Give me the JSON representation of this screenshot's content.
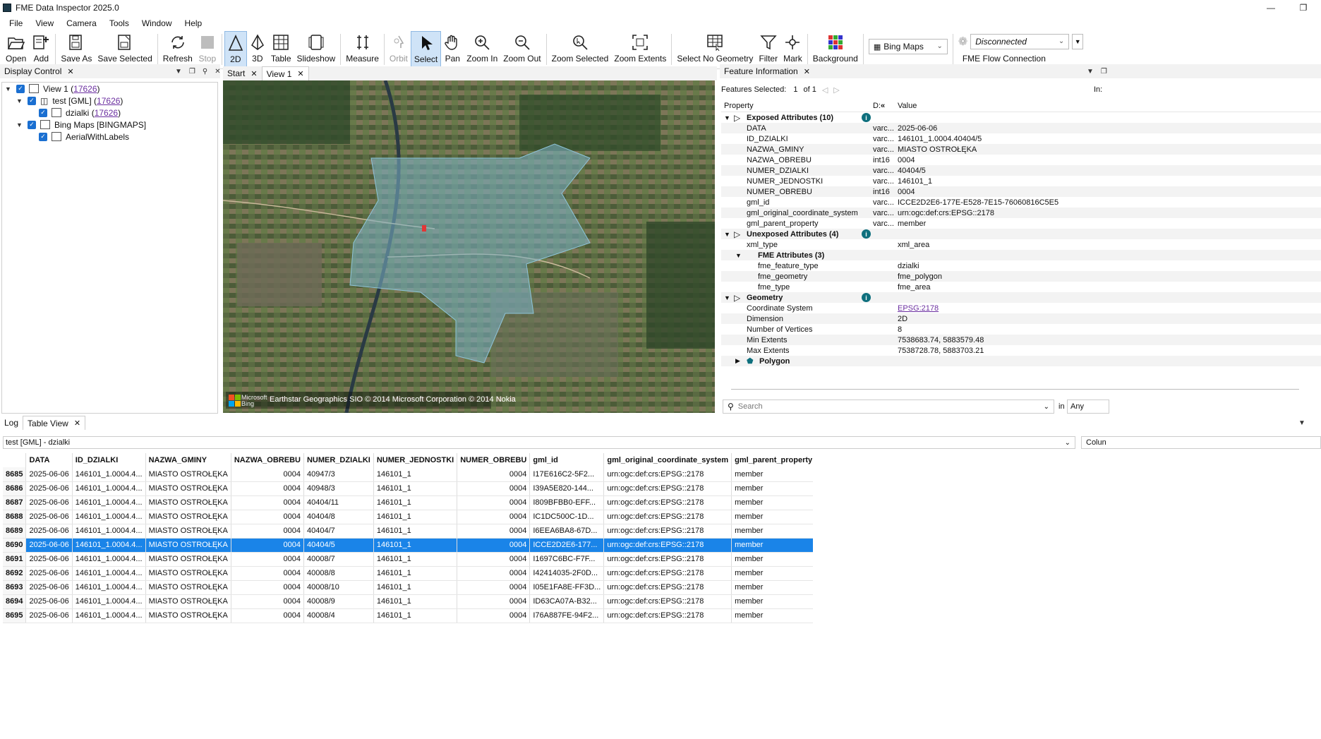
{
  "app": {
    "title": "FME Data Inspector 2025.0"
  },
  "menu": [
    "File",
    "View",
    "Camera",
    "Tools",
    "Window",
    "Help"
  ],
  "toolbar": {
    "open": "Open",
    "add": "Add",
    "save_as": "Save As",
    "save_selected": "Save Selected",
    "refresh": "Refresh",
    "stop": "Stop",
    "view_2d": "2D",
    "view_3d": "3D",
    "table": "Table",
    "slideshow": "Slideshow",
    "measure": "Measure",
    "orbit": "Orbit",
    "select": "Select",
    "pan": "Pan",
    "zoom_in": "Zoom In",
    "zoom_out": "Zoom Out",
    "zoom_selected": "Zoom Selected",
    "zoom_extents": "Zoom Extents",
    "select_no_geometry": "Select No Geometry",
    "filter": "Filter",
    "mark": "Mark",
    "background": "Background",
    "background_combo": "Bing Maps",
    "connection_combo": "Disconnected",
    "connection_label": "FME Flow Connection"
  },
  "display_control": {
    "title": "Display Control",
    "tree": {
      "view": "View 1",
      "view_count": "17626",
      "dataset": "test [GML]",
      "dataset_count": "17626",
      "feature_type": "dzialki",
      "feature_type_count": "17626",
      "background": "Bing Maps [BINGMAPS]",
      "background_layer": "AerialWithLabels"
    }
  },
  "view_tabs": {
    "start": "Start",
    "view1": "View 1"
  },
  "map": {
    "attribution": "Earthstar Geographics SIO © 2014 Microsoft Corporation © 2014 Nokia",
    "logo_top": "Microsoft",
    "logo_bottom": "Bing"
  },
  "feature_info": {
    "title": "Feature Information",
    "selected_label": "Features Selected:",
    "selected_index": "1",
    "selected_of": "of 1",
    "right_label": "In:",
    "col_property": "Property",
    "col_type": "D:",
    "col_value": "Value",
    "exposed_header": "Exposed Attributes (10)",
    "exposed": [
      {
        "name": "DATA",
        "type": "varc...",
        "value": "2025-06-06"
      },
      {
        "name": "ID_DZIALKI",
        "type": "varc...",
        "value": "146101_1.0004.40404/5"
      },
      {
        "name": "NAZWA_GMINY",
        "type": "varc...",
        "value": "MIASTO OSTROŁĘKA"
      },
      {
        "name": "NAZWA_OBREBU",
        "type": "int16",
        "value": "0004"
      },
      {
        "name": "NUMER_DZIALKI",
        "type": "varc...",
        "value": "40404/5"
      },
      {
        "name": "NUMER_JEDNOSTKI",
        "type": "varc...",
        "value": "146101_1"
      },
      {
        "name": "NUMER_OBREBU",
        "type": "int16",
        "value": "0004"
      },
      {
        "name": "gml_id",
        "type": "varc...",
        "value": "ICCE2D2E6-177E-E528-7E15-76060816C5E5"
      },
      {
        "name": "gml_original_coordinate_system",
        "type": "varc...",
        "value": "urn:ogc:def:crs:EPSG::2178"
      },
      {
        "name": "gml_parent_property",
        "type": "varc...",
        "value": "member"
      }
    ],
    "unexposed_header": "Unexposed Attributes (4)",
    "xml_type_name": "xml_type",
    "xml_type_value": "xml_area",
    "fme_header": "FME Attributes (3)",
    "fme_attrs": [
      {
        "name": "fme_feature_type",
        "value": "dzialki"
      },
      {
        "name": "fme_geometry",
        "value": "fme_polygon"
      },
      {
        "name": "fme_type",
        "value": "fme_area"
      }
    ],
    "geometry_header": "Geometry",
    "geometry": [
      {
        "name": "Coordinate System",
        "value": "EPSG:2178"
      },
      {
        "name": "Dimension",
        "value": "2D"
      },
      {
        "name": "Number of Vertices",
        "value": "8"
      },
      {
        "name": "Min Extents",
        "value": "7538683.74, 5883579.48"
      },
      {
        "name": "Max Extents",
        "value": "7538728.78, 5883703.21"
      }
    ],
    "polygon_label": "Polygon",
    "search_placeholder": "Search",
    "in_label": "in",
    "in_value": "Any"
  },
  "bottom_tabs": {
    "log": "Log",
    "table_view": "Table View"
  },
  "table": {
    "source": "test [GML] - dzialki",
    "columns_button": "Colun",
    "columns": [
      "DATA",
      "ID_DZIALKI",
      "NAZWA_GMINY",
      "NAZWA_OBREBU",
      "NUMER_DZIALKI",
      "NUMER_JEDNOSTKI",
      "NUMER_OBREBU",
      "gml_id",
      "gml_original_coordinate_system",
      "gml_parent_property"
    ],
    "rows": [
      [
        "8685",
        "2025-06-06",
        "146101_1.0004.4...",
        "MIASTO OSTROŁĘKA",
        "0004",
        "40947/3",
        "146101_1",
        "0004",
        "I17E616C2-5F2...",
        "urn:ogc:def:crs:EPSG::2178",
        "member"
      ],
      [
        "8686",
        "2025-06-06",
        "146101_1.0004.4...",
        "MIASTO OSTROŁĘKA",
        "0004",
        "40948/3",
        "146101_1",
        "0004",
        "I39A5E820-144...",
        "urn:ogc:def:crs:EPSG::2178",
        "member"
      ],
      [
        "8687",
        "2025-06-06",
        "146101_1.0004.4...",
        "MIASTO OSTROŁĘKA",
        "0004",
        "40404/11",
        "146101_1",
        "0004",
        "I809BFBB0-EFF...",
        "urn:ogc:def:crs:EPSG::2178",
        "member"
      ],
      [
        "8688",
        "2025-06-06",
        "146101_1.0004.4...",
        "MIASTO OSTROŁĘKA",
        "0004",
        "40404/8",
        "146101_1",
        "0004",
        "IC1DC500C-1D...",
        "urn:ogc:def:crs:EPSG::2178",
        "member"
      ],
      [
        "8689",
        "2025-06-06",
        "146101_1.0004.4...",
        "MIASTO OSTROŁĘKA",
        "0004",
        "40404/7",
        "146101_1",
        "0004",
        "I6EEA6BA8-67D...",
        "urn:ogc:def:crs:EPSG::2178",
        "member"
      ],
      [
        "8690",
        "2025-06-06",
        "146101_1.0004.4...",
        "MIASTO OSTROŁĘKA",
        "0004",
        "40404/5",
        "146101_1",
        "0004",
        "ICCE2D2E6-177...",
        "urn:ogc:def:crs:EPSG::2178",
        "member"
      ],
      [
        "8691",
        "2025-06-06",
        "146101_1.0004.4...",
        "MIASTO OSTROŁĘKA",
        "0004",
        "40008/7",
        "146101_1",
        "0004",
        "I1697C6BC-F7F...",
        "urn:ogc:def:crs:EPSG::2178",
        "member"
      ],
      [
        "8692",
        "2025-06-06",
        "146101_1.0004.4...",
        "MIASTO OSTROŁĘKA",
        "0004",
        "40008/8",
        "146101_1",
        "0004",
        "I42414035-2F0D...",
        "urn:ogc:def:crs:EPSG::2178",
        "member"
      ],
      [
        "8693",
        "2025-06-06",
        "146101_1.0004.4...",
        "MIASTO OSTROŁĘKA",
        "0004",
        "40008/10",
        "146101_1",
        "0004",
        "I05E1FA8E-FF3D...",
        "urn:ogc:def:crs:EPSG::2178",
        "member"
      ],
      [
        "8694",
        "2025-06-06",
        "146101_1.0004.4...",
        "MIASTO OSTROŁĘKA",
        "0004",
        "40008/9",
        "146101_1",
        "0004",
        "ID63CA07A-B32...",
        "urn:ogc:def:crs:EPSG::2178",
        "member"
      ],
      [
        "8695",
        "2025-06-06",
        "146101_1.0004.4...",
        "MIASTO OSTROŁĘKA",
        "0004",
        "40008/4",
        "146101_1",
        "0004",
        "I76A887FE-94F2...",
        "urn:ogc:def:crs:EPSG::2178",
        "member"
      ]
    ],
    "selected_row": "8690"
  }
}
